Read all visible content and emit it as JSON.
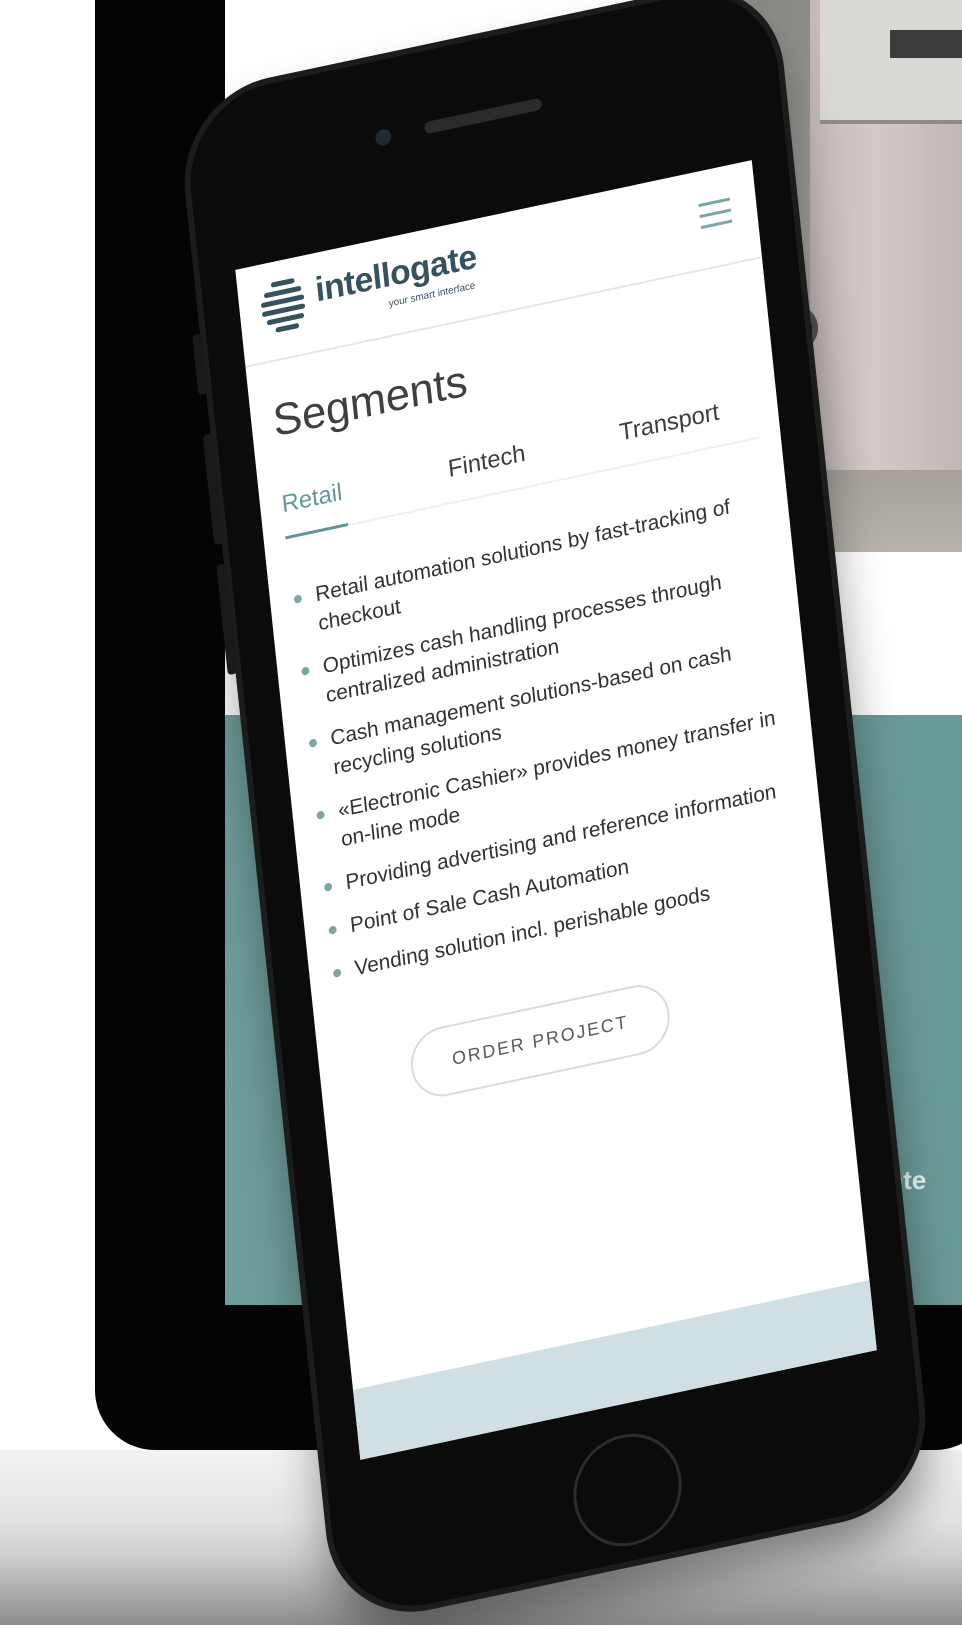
{
  "header": {
    "logo_text": "intellogate",
    "logo_tagline": "your smart interface"
  },
  "page": {
    "title": "Segments"
  },
  "tabs": [
    {
      "label": "Retail",
      "active": true
    },
    {
      "label": "Fintech",
      "active": false
    },
    {
      "label": "Transport",
      "active": false
    }
  ],
  "bullets": [
    "Retail automation solutions by fast-tracking of checkout",
    "Optimizes cash handling processes through centralized administration",
    "Cash management solutions-based on cash recycling solutions",
    "«Electronic Cashier» provides money transfer in on-line mode",
    "Providing advertising and reference information",
    "Point of Sale Cash Automation",
    "Vending solution incl. perishable goods"
  ],
  "cta": {
    "order_label": "ORDER PROJECT"
  },
  "background": {
    "panel_text": "Inte"
  },
  "colors": {
    "accent": "#5f9795",
    "brand_dark": "#36525f",
    "teal_panel": "#6f9d9c"
  }
}
